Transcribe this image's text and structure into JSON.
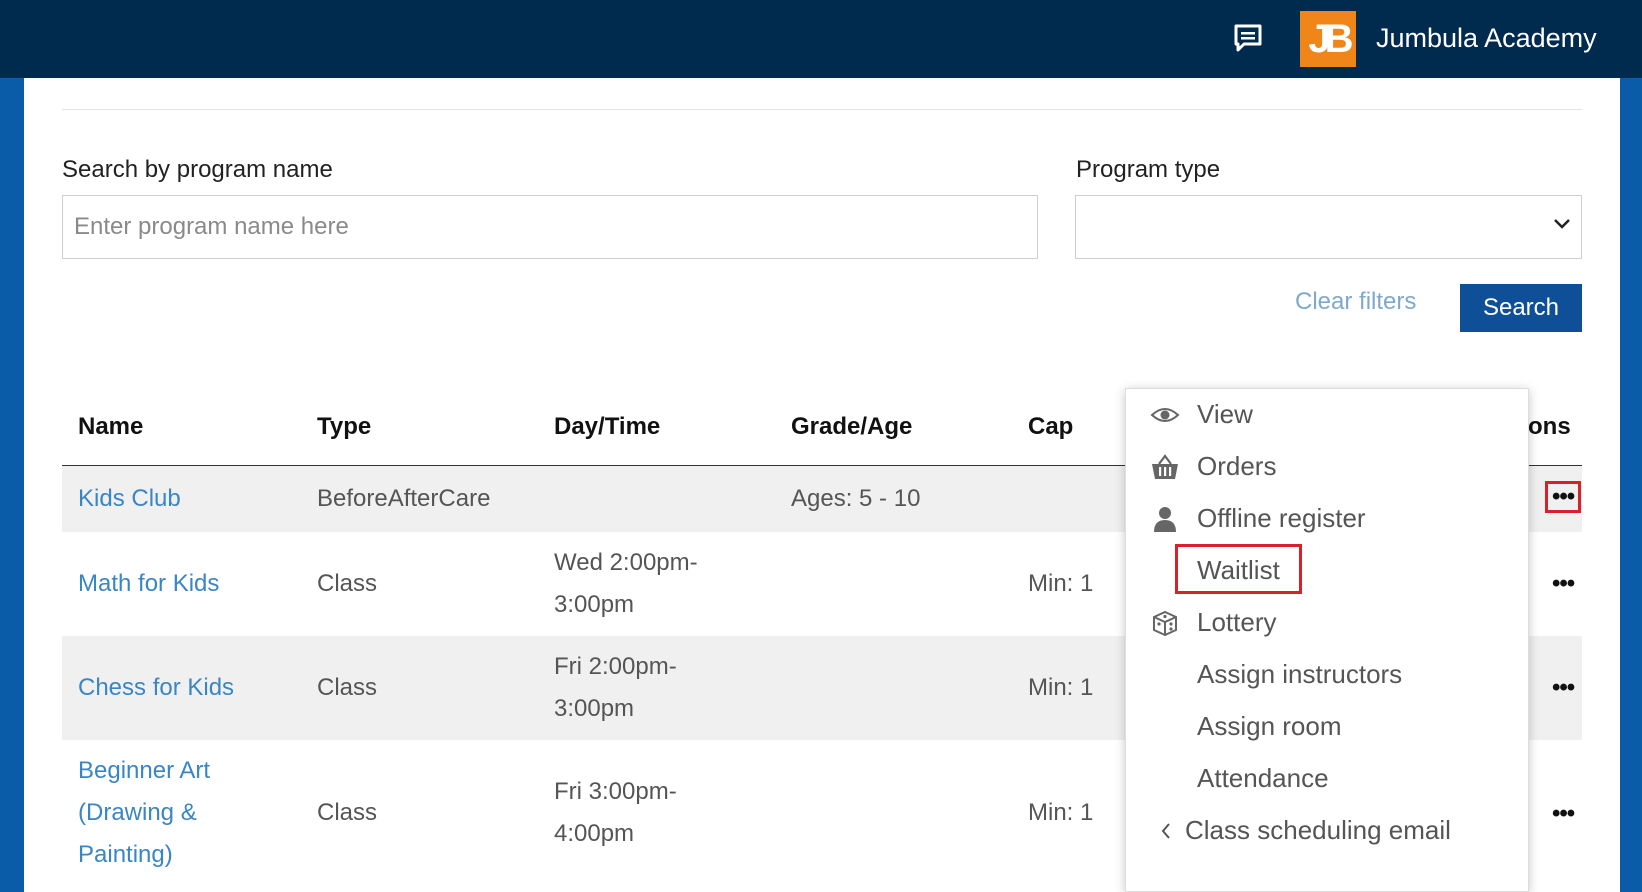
{
  "header": {
    "org_name": "Jumbula Academy",
    "logo_text": "JB",
    "icons": {
      "chat": "chat-icon"
    }
  },
  "filters": {
    "search_label": "Search by program name",
    "search_placeholder": "Enter program name here",
    "search_value": "",
    "type_label": "Program type",
    "type_value": "",
    "clear_label": "Clear filters",
    "search_button": "Search"
  },
  "table": {
    "columns": [
      "Name",
      "Type",
      "Day/Time",
      "Grade/Age",
      "Cap",
      "ons"
    ],
    "rows": [
      {
        "name": "Kids Club",
        "type": "BeforeAfterCare",
        "time": "",
        "grade": "Ages: 5 - 10",
        "cap": ""
      },
      {
        "name": "Math for Kids",
        "type": "Class",
        "time": "Wed 2:00pm-\n3:00pm",
        "grade": "",
        "cap": "Min: 1"
      },
      {
        "name": "Chess for Kids",
        "type": "Class",
        "time": "Fri 2:00pm-\n3:00pm",
        "grade": "",
        "cap": "Min: 1"
      },
      {
        "name": "Beginner Art\n(Drawing &\nPainting)",
        "type": "Class",
        "time": "Fri 3:00pm-\n4:00pm",
        "grade": "",
        "cap": "Min: 1"
      }
    ],
    "more_glyph": "•••"
  },
  "menu": {
    "items": [
      {
        "label": "View",
        "icon": "eye-icon"
      },
      {
        "label": "Orders",
        "icon": "basket-icon"
      },
      {
        "label": "Offline register",
        "icon": "person-icon"
      },
      {
        "label": "Waitlist",
        "icon": ""
      },
      {
        "label": "Lottery",
        "icon": "dice-icon"
      },
      {
        "label": "Assign instructors",
        "icon": ""
      },
      {
        "label": "Assign room",
        "icon": ""
      },
      {
        "label": "Attendance",
        "icon": ""
      },
      {
        "label": "Class scheduling email",
        "icon": "chevron-left-icon"
      }
    ]
  },
  "colors": {
    "header_bg": "#002b4f",
    "accent": "#0f4f98",
    "link": "#3a86c4",
    "highlight": "#d9212c",
    "logo": "#f08519"
  }
}
